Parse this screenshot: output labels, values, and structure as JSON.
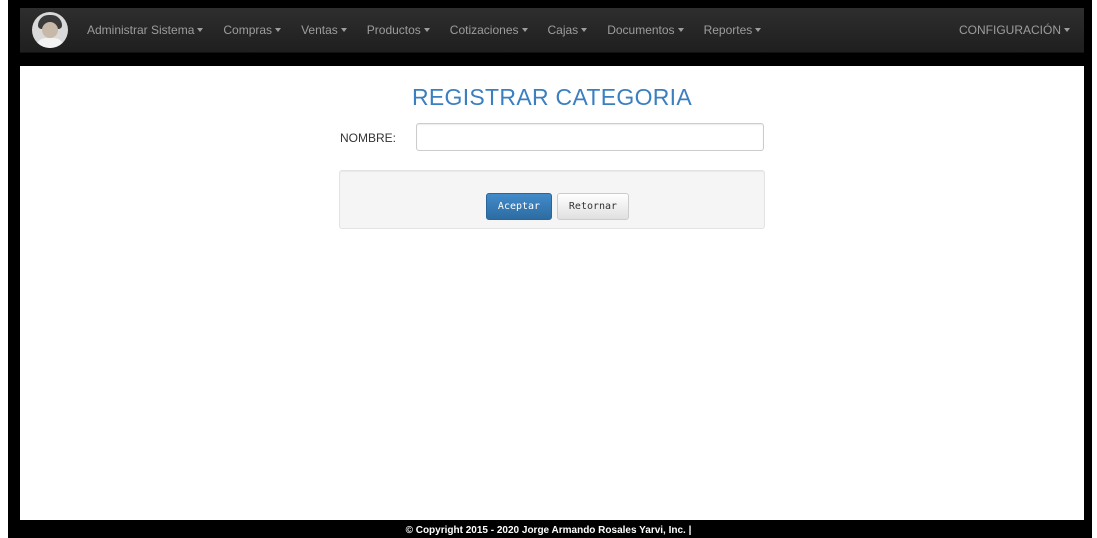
{
  "navbar": {
    "items": [
      {
        "label": "Administrar Sistema"
      },
      {
        "label": "Compras"
      },
      {
        "label": "Ventas"
      },
      {
        "label": "Productos"
      },
      {
        "label": "Cotizaciones"
      },
      {
        "label": "Cajas"
      },
      {
        "label": "Documentos"
      },
      {
        "label": "Reportes"
      }
    ],
    "config_label": "CONFIGURACIÓN"
  },
  "page": {
    "title": "REGISTRAR CATEGORIA"
  },
  "form": {
    "name_label": "NOMBRE:",
    "name_value": "",
    "accept_label": "Aceptar",
    "return_label": "Retornar"
  },
  "footer": {
    "text": "© Copyright 2015 - 2020 Jorge Armando Rosales Yarvi, Inc. |"
  },
  "colors": {
    "navbar_bg": "#222222",
    "title": "#3a7fc1",
    "primary": "#428bca"
  }
}
